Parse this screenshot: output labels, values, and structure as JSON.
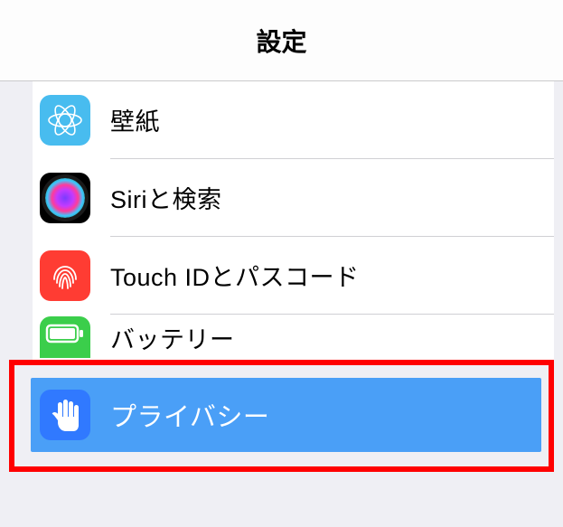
{
  "header": {
    "title": "設定"
  },
  "rows": {
    "wallpaper": {
      "label": "壁紙"
    },
    "siri": {
      "label": "Siriと検索"
    },
    "touchid": {
      "label": "Touch IDとパスコード"
    },
    "battery": {
      "label": "バッテリー"
    },
    "privacy": {
      "label": "プライバシー"
    }
  }
}
